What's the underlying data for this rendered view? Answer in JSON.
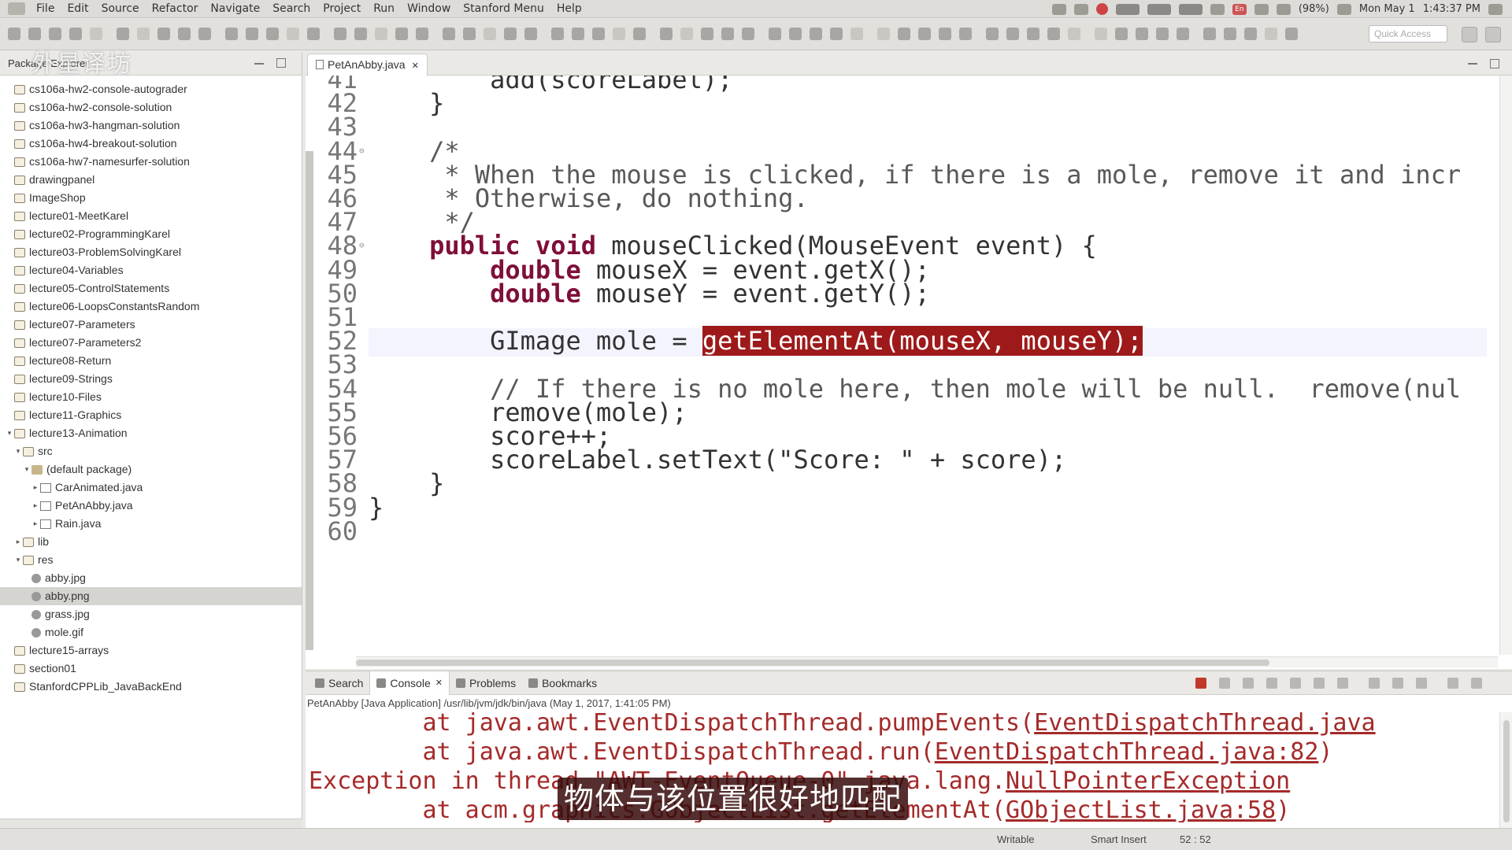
{
  "menubar": {
    "items": [
      "File",
      "Edit",
      "Source",
      "Refactor",
      "Navigate",
      "Search",
      "Project",
      "Run",
      "Window",
      "Stanford Menu",
      "Help"
    ],
    "battery": "(98%)",
    "date": "Mon May 1",
    "time": "1:43:37 PM",
    "lang": "En"
  },
  "toolbar": {
    "quick_access_placeholder": "Quick Access"
  },
  "package_explorer": {
    "title": "Package Explorer",
    "items": [
      {
        "label": "cs106a-hw2-console-autograder",
        "depth": 0,
        "icon": "folder",
        "twisty": ""
      },
      {
        "label": "cs106a-hw2-console-solution",
        "depth": 0,
        "icon": "folder",
        "twisty": ""
      },
      {
        "label": "cs106a-hw3-hangman-solution",
        "depth": 0,
        "icon": "folder",
        "twisty": ""
      },
      {
        "label": "cs106a-hw4-breakout-solution",
        "depth": 0,
        "icon": "folder",
        "twisty": ""
      },
      {
        "label": "cs106a-hw7-namesurfer-solution",
        "depth": 0,
        "icon": "folder",
        "twisty": ""
      },
      {
        "label": "drawingpanel",
        "depth": 0,
        "icon": "folder",
        "twisty": ""
      },
      {
        "label": "ImageShop",
        "depth": 0,
        "icon": "folder",
        "twisty": ""
      },
      {
        "label": "lecture01-MeetKarel",
        "depth": 0,
        "icon": "folder",
        "twisty": ""
      },
      {
        "label": "lecture02-ProgrammingKarel",
        "depth": 0,
        "icon": "folder",
        "twisty": ""
      },
      {
        "label": "lecture03-ProblemSolvingKarel",
        "depth": 0,
        "icon": "folder",
        "twisty": ""
      },
      {
        "label": "lecture04-Variables",
        "depth": 0,
        "icon": "folder",
        "twisty": ""
      },
      {
        "label": "lecture05-ControlStatements",
        "depth": 0,
        "icon": "folder",
        "twisty": ""
      },
      {
        "label": "lecture06-LoopsConstantsRandom",
        "depth": 0,
        "icon": "folder",
        "twisty": ""
      },
      {
        "label": "lecture07-Parameters",
        "depth": 0,
        "icon": "folder",
        "twisty": ""
      },
      {
        "label": "lecture07-Parameters2",
        "depth": 0,
        "icon": "folder",
        "twisty": ""
      },
      {
        "label": "lecture08-Return",
        "depth": 0,
        "icon": "folder",
        "twisty": ""
      },
      {
        "label": "lecture09-Strings",
        "depth": 0,
        "icon": "folder",
        "twisty": ""
      },
      {
        "label": "lecture10-Files",
        "depth": 0,
        "icon": "folder",
        "twisty": ""
      },
      {
        "label": "lecture11-Graphics",
        "depth": 0,
        "icon": "folder",
        "twisty": ""
      },
      {
        "label": "lecture13-Animation",
        "depth": 0,
        "icon": "folder",
        "twisty": "▾"
      },
      {
        "label": "src",
        "depth": 1,
        "icon": "folder",
        "twisty": "▾"
      },
      {
        "label": "(default package)",
        "depth": 2,
        "icon": "pkg",
        "twisty": "▾"
      },
      {
        "label": "CarAnimated.java",
        "depth": 3,
        "icon": "java",
        "twisty": "▸"
      },
      {
        "label": "PetAnAbby.java",
        "depth": 3,
        "icon": "java",
        "twisty": "▸"
      },
      {
        "label": "Rain.java",
        "depth": 3,
        "icon": "java",
        "twisty": "▸"
      },
      {
        "label": "lib",
        "depth": 1,
        "icon": "folder",
        "twisty": "▸"
      },
      {
        "label": "res",
        "depth": 1,
        "icon": "folder",
        "twisty": "▾"
      },
      {
        "label": "abby.jpg",
        "depth": 2,
        "icon": "img",
        "twisty": ""
      },
      {
        "label": "abby.png",
        "depth": 2,
        "icon": "img",
        "twisty": "",
        "selected": true
      },
      {
        "label": "grass.jpg",
        "depth": 2,
        "icon": "img",
        "twisty": ""
      },
      {
        "label": "mole.gif",
        "depth": 2,
        "icon": "img",
        "twisty": ""
      },
      {
        "label": "lecture15-arrays",
        "depth": 0,
        "icon": "folder",
        "twisty": ""
      },
      {
        "label": "section01",
        "depth": 0,
        "icon": "folder",
        "twisty": ""
      },
      {
        "label": "StanfordCPPLib_JavaBackEnd",
        "depth": 0,
        "icon": "folder",
        "twisty": ""
      }
    ]
  },
  "editor": {
    "tab_label": "PetAnAbby.java",
    "lines": [
      {
        "n": "41",
        "parts": [
          {
            "t": "        add(scoreLabel);",
            "c": "fn"
          }
        ]
      },
      {
        "n": "42",
        "parts": [
          {
            "t": "    }",
            "c": "fn"
          }
        ]
      },
      {
        "n": "43",
        "parts": []
      },
      {
        "n": "44",
        "parts": [
          {
            "t": "    /*",
            "c": "cm"
          }
        ]
      },
      {
        "n": "45",
        "parts": [
          {
            "t": "     * When the mouse is clicked, if there is a mole, remove it and incr",
            "c": "cm"
          }
        ]
      },
      {
        "n": "46",
        "parts": [
          {
            "t": "     * Otherwise, do nothing.",
            "c": "cm"
          }
        ]
      },
      {
        "n": "47",
        "parts": [
          {
            "t": "     */",
            "c": "cm"
          }
        ]
      },
      {
        "n": "48",
        "parts": [
          {
            "t": "    ",
            "c": "fn"
          },
          {
            "t": "public void",
            "c": "kw"
          },
          {
            "t": " mouseClicked(MouseEvent event) {",
            "c": "fn"
          }
        ]
      },
      {
        "n": "49",
        "parts": [
          {
            "t": "        ",
            "c": "fn"
          },
          {
            "t": "double",
            "c": "kw"
          },
          {
            "t": " mouseX = event.getX();",
            "c": "fn"
          }
        ]
      },
      {
        "n": "50",
        "parts": [
          {
            "t": "        ",
            "c": "fn"
          },
          {
            "t": "double",
            "c": "kw"
          },
          {
            "t": " mouseY = event.",
            "c": "fn"
          },
          {
            "t": "getY",
            "c": "fn"
          },
          {
            "t": "();",
            "c": "fn"
          }
        ]
      },
      {
        "n": "51",
        "parts": []
      },
      {
        "n": "52",
        "parts": [
          {
            "t": "        GImage mole = ",
            "c": "fn"
          },
          {
            "t": "getElementAt(mouseX, mouseY);",
            "c": "hl"
          }
        ]
      },
      {
        "n": "53",
        "parts": []
      },
      {
        "n": "54",
        "parts": [
          {
            "t": "        // If there is no mole here, then mole will be null.  remove(nul",
            "c": "cm"
          }
        ]
      },
      {
        "n": "55",
        "parts": [
          {
            "t": "        remove(mole);",
            "c": "fn"
          }
        ]
      },
      {
        "n": "56",
        "parts": [
          {
            "t": "        score++;",
            "c": "fn"
          }
        ]
      },
      {
        "n": "57",
        "parts": [
          {
            "t": "        scoreLabel.setText(\"Score: \" + score);",
            "c": "fn"
          }
        ]
      },
      {
        "n": "58",
        "parts": [
          {
            "t": "    }",
            "c": "fn"
          }
        ]
      },
      {
        "n": "59",
        "parts": [
          {
            "t": "}",
            "c": "fn"
          }
        ]
      },
      {
        "n": "60",
        "parts": []
      }
    ]
  },
  "console": {
    "tabs": [
      {
        "label": "Search",
        "active": false,
        "closable": false
      },
      {
        "label": "Console",
        "active": true,
        "closable": true
      },
      {
        "label": "Problems",
        "active": false,
        "closable": false
      },
      {
        "label": "Bookmarks",
        "active": false,
        "closable": false
      }
    ],
    "description": "PetAnAbby [Java Application] /usr/lib/jvm/jdk/bin/java (May 1, 2017, 1:41:05 PM)",
    "lines": [
      {
        "pre": "        at java.awt.EventDispatchThread.pumpEvents(",
        "link": "EventDispatchThread.java",
        "post": ""
      },
      {
        "pre": "        at java.awt.EventDispatchThread.run(",
        "link": "EventDispatchThread.java:82",
        "post": ")"
      },
      {
        "pre": "Exception in thread \"AWT-EventQueue-0\" java.lang.",
        "link": "NullPointerException",
        "post": ""
      },
      {
        "pre": "        at acm.graphics.GObjectList.getElementAt(",
        "link": "GObjectList.java:58",
        "post": ")"
      }
    ]
  },
  "subtitle": "物体与该位置很好地匹配",
  "watermark": "外星译坊",
  "status": {
    "writable": "Writable",
    "insert_mode": "Smart Insert",
    "position": "52 : 52"
  }
}
